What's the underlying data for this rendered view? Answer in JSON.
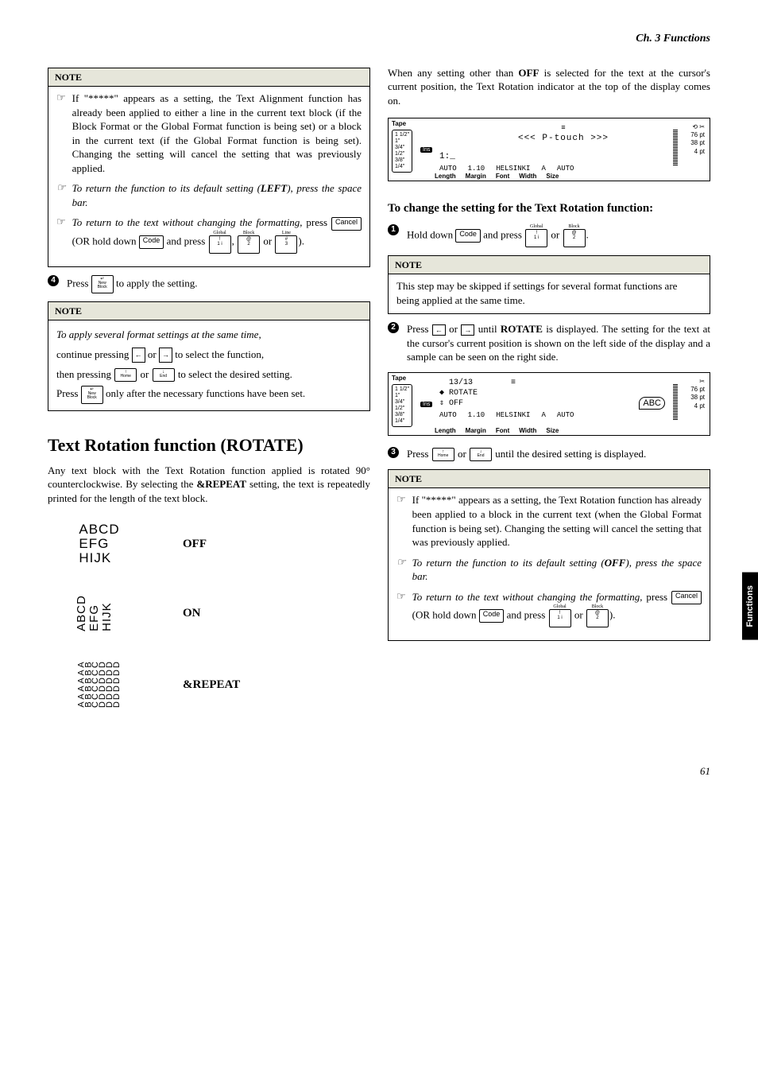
{
  "chapter": "Ch. 3 Functions",
  "side_tab": "Functions",
  "page_number": "61",
  "left": {
    "note1": {
      "title": "NOTE",
      "item1": "If \"*****\" appears as a setting, the Text Alignment function has already been applied to either a line in the current text block (if the Block Format or the Global Format function is being set) or a block in the current text (if the Global Format function is being set). Changing the setting will cancel the setting that was previously applied.",
      "item2_pre": "To return the function to its default setting (",
      "item2_bold": "LEFT",
      "item2_post": "), press the space bar.",
      "item3_pre": "To return to the text without changing the formatting,",
      "item3_mid": " press ",
      "item3_paren": " (OR hold down ",
      "item3_and": " and press ",
      "item3_comma": ", ",
      "item3_or": " or ",
      "item3_close": ")."
    },
    "step4": "Press ",
    "step4_post": " to apply the setting.",
    "note2": {
      "title": "NOTE",
      "line1": "To apply several format settings at the same time,",
      "line2_pre": "continue pressing ",
      "line2_or": " or ",
      "line2_post": " to select the function,",
      "line3_pre": "then pressing ",
      "line3_or": " or ",
      "line3_post": " to select the desired setting.",
      "line4_pre": "Press ",
      "line4_post": " only after the necessary functions have been set."
    },
    "section_title": "Text Rotation function (ROTATE)",
    "section_para": "Any text block with the Text Rotation function applied is rotated 90° counterclockwise. By selecting the &REPEAT setting, the text is repeatedly printed for the length of the text block.",
    "section_para_bold": "&REPEAT",
    "ex_labels": {
      "off": "OFF",
      "on": "ON",
      "repeat": "&REPEAT"
    },
    "ex_text": {
      "l1": "ABCD",
      "l2": "EFG",
      "l3": "HIJK"
    }
  },
  "right": {
    "intro": "When any setting other than OFF is selected for the text at the cursor's current position, the Text Rotation indicator at the top of the display comes on.",
    "intro_bold": "OFF",
    "lcd1": {
      "tape": "Tape",
      "sizes": [
        "1 1/2\"",
        "1\"",
        "3/4\"",
        "1/2\"",
        "3/8\"",
        "1/4\""
      ],
      "top": "<<< P-touch >>>",
      "mid": "1:_",
      "vals": [
        "AUTO",
        "1.10",
        "HELSINKI",
        "A",
        "AUTO"
      ],
      "labels": [
        "Length",
        "Margin",
        "Font",
        "Width",
        "Size"
      ],
      "pts": [
        "76 pt",
        "38 pt",
        "4 pt"
      ],
      "ins": "Ins"
    },
    "sub": "To change the setting for the Text Rotation function:",
    "step1_pre": "Hold down ",
    "step1_mid": " and press ",
    "step1_or": " or ",
    "step1_close": ".",
    "note1": {
      "title": "NOTE",
      "text": "This step may be skipped if settings for several format functions are being applied at the same time."
    },
    "step2_pre": "Press ",
    "step2_or": " or ",
    "step2_mid": " until ",
    "step2_bold": "ROTATE",
    "step2_post": " is displayed. The setting for the text at the cursor's current position is shown on the left side of the display and a sample can be seen on the right side.",
    "lcd2": {
      "tape": "Tape",
      "sizes": [
        "1 1/2\"",
        "1\"",
        "3/4\"",
        "1/2\"",
        "3/8\"",
        "1/4\""
      ],
      "count": "13/13",
      "rotate": "ROTATE",
      "off": "OFF",
      "abc": "ABC",
      "vals": [
        "AUTO",
        "1.10",
        "HELSINKI",
        "A",
        "AUTO"
      ],
      "labels": [
        "Length",
        "Margin",
        "Font",
        "Width",
        "Size"
      ],
      "pts": [
        "76 pt",
        "38 pt",
        "4 pt"
      ],
      "ins": "Ins"
    },
    "step3_pre": "Press ",
    "step3_or": " or ",
    "step3_post": " until the desired setting is displayed.",
    "note2": {
      "title": "NOTE",
      "item1": "If \"*****\" appears as a setting, the Text Rotation function has already been applied to a block in the current text (when the Global Format function is being set). Changing the setting will cancel the setting that was previously applied.",
      "item2_pre": "To return the function to its default setting (",
      "item2_bold": "OFF",
      "item2_post": "), press the space bar.",
      "item3_pre": "To return to the text without changing the formatting,",
      "item3_mid": " press ",
      "item3_paren": " (OR hold down ",
      "item3_and": " and press ",
      "item3_or": " or ",
      "item3_close": ")."
    }
  },
  "keys": {
    "cancel": "Cancel",
    "code": "Code",
    "global": "Global",
    "block": "Block",
    "line": "Line",
    "one": "1",
    "one_sym": "!",
    "one_sub": "i",
    "two": "2",
    "two_sym": "@",
    "three": "3",
    "three_sym": "#",
    "newblock": "New\nBlock",
    "home": "Home",
    "end": "End"
  }
}
